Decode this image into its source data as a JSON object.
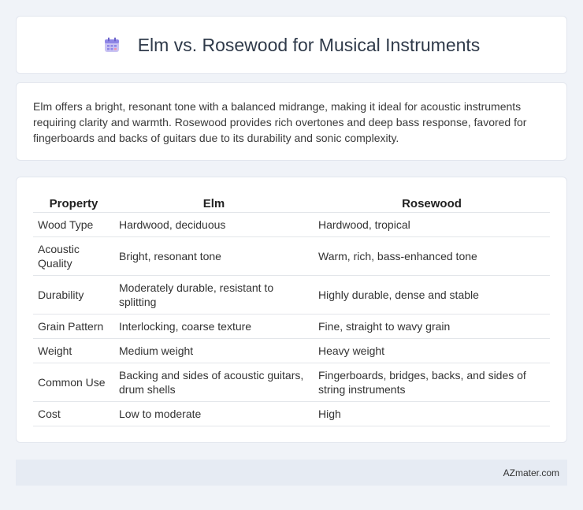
{
  "header": {
    "title": "Elm vs. Rosewood for Musical Instruments",
    "icon": "calendar-icon"
  },
  "summary": {
    "text": "Elm offers a bright, resonant tone with a balanced midrange, making it ideal for acoustic instruments requiring clarity and warmth. Rosewood provides rich overtones and deep bass response, favored for fingerboards and backs of guitars due to its durability and sonic complexity."
  },
  "table": {
    "headers": [
      "Property",
      "Elm",
      "Rosewood"
    ],
    "rows": [
      [
        "Wood Type",
        "Hardwood, deciduous",
        "Hardwood, tropical"
      ],
      [
        "Acoustic Quality",
        "Bright, resonant tone",
        "Warm, rich, bass-enhanced tone"
      ],
      [
        "Durability",
        "Moderately durable, resistant to splitting",
        "Highly durable, dense and stable"
      ],
      [
        "Grain Pattern",
        "Interlocking, coarse texture",
        "Fine, straight to wavy grain"
      ],
      [
        "Weight",
        "Medium weight",
        "Heavy weight"
      ],
      [
        "Common Use",
        "Backing and sides of acoustic guitars, drum shells",
        "Fingerboards, bridges, backs, and sides of string instruments"
      ],
      [
        "Cost",
        "Low to moderate",
        "High"
      ]
    ]
  },
  "footer": {
    "text": "AZmater.com"
  },
  "colors": {
    "background": "#f0f3f8",
    "card": "#ffffff",
    "footer_bar": "#e6ebf3",
    "title_text": "#2f3a4a"
  }
}
